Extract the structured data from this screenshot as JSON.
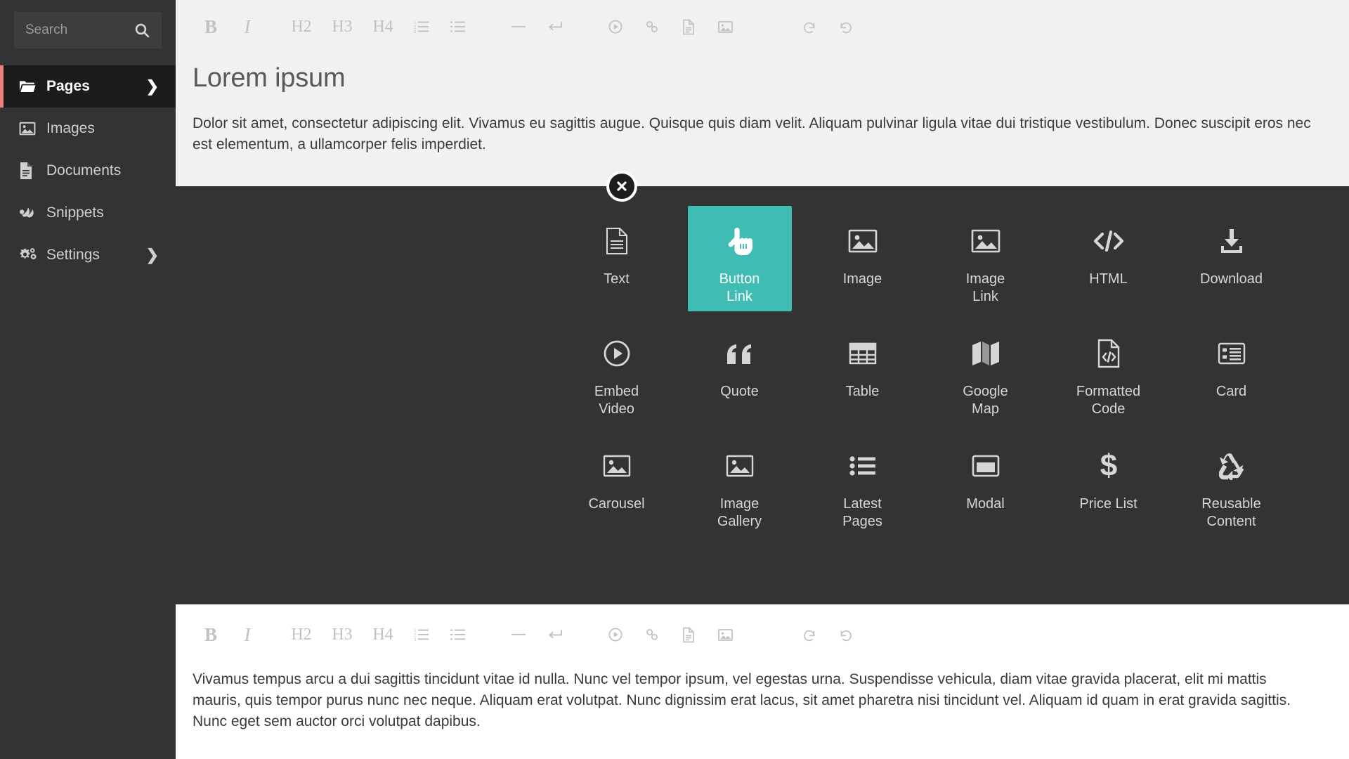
{
  "sidebar": {
    "search": {
      "placeholder": "Search",
      "value": "",
      "icon": "search-icon"
    },
    "items": [
      {
        "label": "Pages",
        "icon": "folder-open-icon",
        "active": true,
        "chevron": "❯"
      },
      {
        "label": "Images",
        "icon": "image-icon",
        "active": false,
        "chevron": ""
      },
      {
        "label": "Documents",
        "icon": "document-icon",
        "active": false,
        "chevron": ""
      },
      {
        "label": "Snippets",
        "icon": "snippet-icon",
        "active": false,
        "chevron": ""
      },
      {
        "label": "Settings",
        "icon": "gears-icon",
        "active": false,
        "chevron": "❯"
      }
    ],
    "accent_color": "#f08080",
    "background_color": "#333333",
    "active_background_color": "#1c1c1c"
  },
  "toolbar": {
    "bold": "B",
    "italic": "I",
    "h2": "H2",
    "h3": "H3",
    "h4": "H4",
    "ordered_list_icon": "ordered-list-icon",
    "unordered_list_icon": "unordered-list-icon",
    "horizontal_rule_icon": "horizontal-rule-icon",
    "line_break_icon": "line-break-icon",
    "video_icon": "video-icon",
    "link_icon": "link-icon",
    "document_icon": "document-icon",
    "image_icon": "image-icon",
    "undo_icon": "undo-icon",
    "redo_icon": "redo-icon"
  },
  "editor_top": {
    "title": "Lorem ipsum",
    "paragraph": "Dolor sit amet, consectetur adipiscing elit. Vivamus eu  sagittis augue. Quisque quis diam velit. Aliquam pulvinar ligula vitae  dui tristique vestibulum. Donec suscipit eros nec est elementum, a  ullamcorper felis imperdiet."
  },
  "editor_bottom": {
    "paragraph": " Vivamus tempus arcu a dui sagittis tincidunt vitae id nulla. Nunc vel  tempor ipsum, vel egestas urna. Suspendisse vehicula, diam vitae gravida  placerat, elit mi mattis mauris, quis tempor purus nunc nec neque.  Aliquam erat volutpat. Nunc dignissim erat lacus, sit amet pharetra nisi  tincidunt vel. Aliquam id quam in erat gravida sagittis. Nunc eget sem  auctor orci volutpat dapibus."
  },
  "picker": {
    "close_label": "close-button",
    "selected_color": "#3fbdb5",
    "background_color": "#333333",
    "blocks": [
      {
        "label": "Text",
        "icon": "text-document-icon",
        "selected": false
      },
      {
        "label": "Button\nLink",
        "icon": "pointing-hand-icon",
        "selected": true
      },
      {
        "label": "Image",
        "icon": "image-icon",
        "selected": false
      },
      {
        "label": "Image\nLink",
        "icon": "image-link-icon",
        "selected": false
      },
      {
        "label": "HTML",
        "icon": "code-brackets-icon",
        "selected": false
      },
      {
        "label": "Download",
        "icon": "download-icon",
        "selected": false
      },
      {
        "label": "Embed\nVideo",
        "icon": "play-circle-icon",
        "selected": false
      },
      {
        "label": "Quote",
        "icon": "quote-marks-icon",
        "selected": false
      },
      {
        "label": "Table",
        "icon": "table-grid-icon",
        "selected": false
      },
      {
        "label": "Google\nMap",
        "icon": "folded-map-icon",
        "selected": false
      },
      {
        "label": "Formatted\nCode",
        "icon": "code-file-icon",
        "selected": false
      },
      {
        "label": "Card",
        "icon": "card-list-icon",
        "selected": false
      },
      {
        "label": "Carousel",
        "icon": "image-icon",
        "selected": false
      },
      {
        "label": "Image\nGallery",
        "icon": "image-icon",
        "selected": false
      },
      {
        "label": "Latest\nPages",
        "icon": "bullet-list-icon",
        "selected": false
      },
      {
        "label": "Modal",
        "icon": "window-icon",
        "selected": false
      },
      {
        "label": "Price List",
        "icon": "dollar-sign-icon",
        "selected": false
      },
      {
        "label": "Reusable\nContent",
        "icon": "recycle-icon",
        "selected": false
      }
    ]
  }
}
